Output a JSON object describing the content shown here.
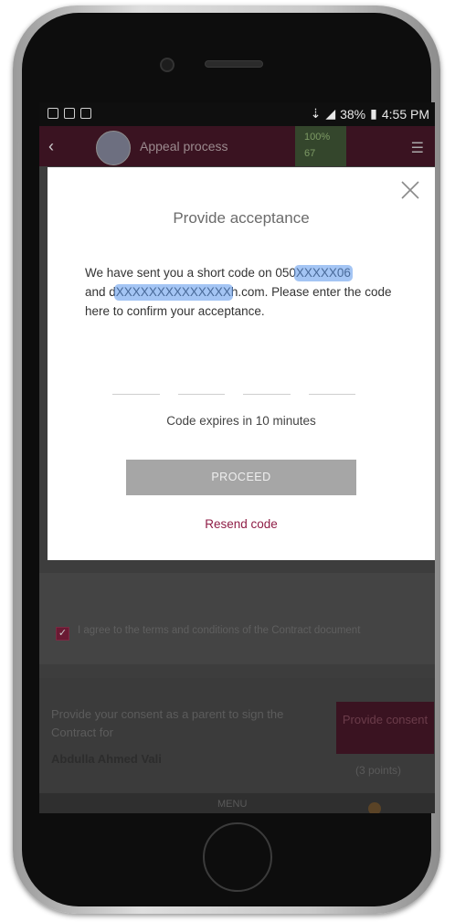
{
  "status_bar": {
    "battery": "38%",
    "time": "4:55 PM"
  },
  "app_bar": {
    "title": "Appeal process",
    "points_top": "100%",
    "points_bottom": "67"
  },
  "modal": {
    "title": "Provide acceptance",
    "message_part1": "We have sent you a short code on 050",
    "phone_redacted": "XXXXX06",
    "message_part2": "and d",
    "email_redacted": "XXXXXXXXXXXXXX",
    "message_part3": "h.com. Please enter the code here to confirm your acceptance.",
    "code_slots": 4,
    "expiry_text": "Code expires in  10 minutes",
    "proceed_label": "PROCEED",
    "resend_label": "Resend code"
  },
  "background": {
    "terms_text": "I agree to the terms and conditions of the Contract document",
    "consent_prompt": "Provide your consent as a parent to sign the Contract for",
    "student_name": "Abdulla Ahmed Vali",
    "consent_button": "Provide consent",
    "points_note": "(3 points)",
    "menu_label": "MENU"
  },
  "colors": {
    "accent": "#8f1d46",
    "appbar": "#3a1321",
    "button_disabled": "#a6a6a6"
  }
}
